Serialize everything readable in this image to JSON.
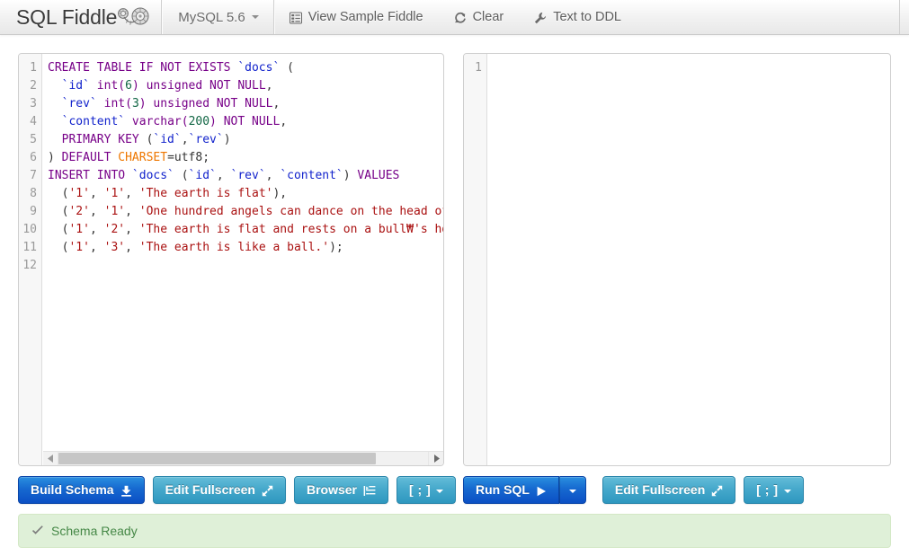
{
  "navbar": {
    "brand": "SQL Fiddle",
    "brand_logo_icon": "fiddlehead-fern-icon",
    "db_label": "MySQL 5.6",
    "items": [
      {
        "label": "View Sample Fiddle",
        "icon": "list-alt-icon"
      },
      {
        "label": "Clear",
        "icon": "refresh-icon"
      },
      {
        "label": "Text to DDL",
        "icon": "wrench-icon"
      }
    ]
  },
  "schema_editor": {
    "lines": [
      [
        {
          "t": "CREATE TABLE IF NOT EXISTS ",
          "c": "tok-kw"
        },
        {
          "t": "`docs`",
          "c": "tok-id"
        },
        {
          "t": " (",
          "c": "tok-op"
        }
      ],
      [
        {
          "t": "  ",
          "c": "tok-pln"
        },
        {
          "t": "`id`",
          "c": "tok-id"
        },
        {
          "t": " int(",
          "c": "tok-kw"
        },
        {
          "t": "6",
          "c": "tok-num"
        },
        {
          "t": ") unsigned NOT NULL",
          "c": "tok-kw"
        },
        {
          "t": ",",
          "c": "tok-op"
        }
      ],
      [
        {
          "t": "  ",
          "c": "tok-pln"
        },
        {
          "t": "`rev`",
          "c": "tok-id"
        },
        {
          "t": " int(",
          "c": "tok-kw"
        },
        {
          "t": "3",
          "c": "tok-num"
        },
        {
          "t": ") unsigned NOT NULL",
          "c": "tok-kw"
        },
        {
          "t": ",",
          "c": "tok-op"
        }
      ],
      [
        {
          "t": "  ",
          "c": "tok-pln"
        },
        {
          "t": "`content`",
          "c": "tok-id"
        },
        {
          "t": " varchar(",
          "c": "tok-kw"
        },
        {
          "t": "200",
          "c": "tok-num"
        },
        {
          "t": ") NOT NULL",
          "c": "tok-kw"
        },
        {
          "t": ",",
          "c": "tok-op"
        }
      ],
      [
        {
          "t": "  PRIMARY KEY ",
          "c": "tok-kw"
        },
        {
          "t": "(",
          "c": "tok-op"
        },
        {
          "t": "`id`",
          "c": "tok-id"
        },
        {
          "t": ",",
          "c": "tok-op"
        },
        {
          "t": "`rev`",
          "c": "tok-id"
        },
        {
          "t": ")",
          "c": "tok-op"
        }
      ],
      [
        {
          "t": ") ",
          "c": "tok-op"
        },
        {
          "t": "DEFAULT ",
          "c": "tok-kw"
        },
        {
          "t": "CHARSET",
          "c": "tok-var"
        },
        {
          "t": "=utf8;",
          "c": "tok-pln"
        }
      ],
      [
        {
          "t": "INSERT INTO ",
          "c": "tok-kw"
        },
        {
          "t": "`docs`",
          "c": "tok-id"
        },
        {
          "t": " (",
          "c": "tok-op"
        },
        {
          "t": "`id`",
          "c": "tok-id"
        },
        {
          "t": ", ",
          "c": "tok-op"
        },
        {
          "t": "`rev`",
          "c": "tok-id"
        },
        {
          "t": ", ",
          "c": "tok-op"
        },
        {
          "t": "`content`",
          "c": "tok-id"
        },
        {
          "t": ") ",
          "c": "tok-op"
        },
        {
          "t": "VALUES",
          "c": "tok-kw"
        }
      ],
      [
        {
          "t": "  (",
          "c": "tok-op"
        },
        {
          "t": "'1'",
          "c": "tok-str"
        },
        {
          "t": ", ",
          "c": "tok-op"
        },
        {
          "t": "'1'",
          "c": "tok-str"
        },
        {
          "t": ", ",
          "c": "tok-op"
        },
        {
          "t": "'The earth is flat'",
          "c": "tok-str"
        },
        {
          "t": "),",
          "c": "tok-op"
        }
      ],
      [
        {
          "t": "  (",
          "c": "tok-op"
        },
        {
          "t": "'2'",
          "c": "tok-str"
        },
        {
          "t": ", ",
          "c": "tok-op"
        },
        {
          "t": "'1'",
          "c": "tok-str"
        },
        {
          "t": ", ",
          "c": "tok-op"
        },
        {
          "t": "'One hundred angels can dance on the head of a pin'",
          "c": "tok-str"
        },
        {
          "t": "),",
          "c": "tok-op"
        }
      ],
      [
        {
          "t": "  (",
          "c": "tok-op"
        },
        {
          "t": "'1'",
          "c": "tok-str"
        },
        {
          "t": ", ",
          "c": "tok-op"
        },
        {
          "t": "'2'",
          "c": "tok-str"
        },
        {
          "t": ", ",
          "c": "tok-op"
        },
        {
          "t": "'The earth is flat and rests on a bull₩'s horn'",
          "c": "tok-str"
        },
        {
          "t": "),",
          "c": "tok-op"
        }
      ],
      [
        {
          "t": "  (",
          "c": "tok-op"
        },
        {
          "t": "'1'",
          "c": "tok-str"
        },
        {
          "t": ", ",
          "c": "tok-op"
        },
        {
          "t": "'3'",
          "c": "tok-str"
        },
        {
          "t": ", ",
          "c": "tok-op"
        },
        {
          "t": "'The earth is like a ball.'",
          "c": "tok-str"
        },
        {
          "t": ");",
          "c": "tok-op"
        }
      ],
      []
    ],
    "line_numbers": [
      "1",
      "2",
      "3",
      "4",
      "5",
      "6",
      "7",
      "8",
      "9",
      "10",
      "11",
      "12"
    ]
  },
  "query_editor": {
    "lines": [
      []
    ],
    "line_numbers": [
      "1"
    ]
  },
  "schema_buttons": {
    "build": {
      "label": "Build Schema",
      "icon": "download-icon"
    },
    "fullscreen": {
      "label": "Edit Fullscreen",
      "icon": "resize-full-icon"
    },
    "browser": {
      "label": "Browser",
      "icon": "indent-right-icon"
    },
    "separator": {
      "label": "[ ; ]"
    }
  },
  "query_buttons": {
    "run": {
      "label": "Run SQL",
      "icon": "play-icon"
    },
    "fullscreen": {
      "label": "Edit Fullscreen",
      "icon": "resize-full-icon"
    },
    "separator": {
      "label": "[ ; ]"
    }
  },
  "status": {
    "icon": "check-icon",
    "message": "Schema Ready"
  },
  "colors": {
    "primary": "#1669d0",
    "info": "#45a8cb",
    "status_bg": "#dff0d8",
    "status_text": "#468847",
    "keyword": "#770088",
    "identifier": "#1122cc",
    "number": "#116644",
    "string": "#aa1111",
    "variable": "#ee7700"
  }
}
